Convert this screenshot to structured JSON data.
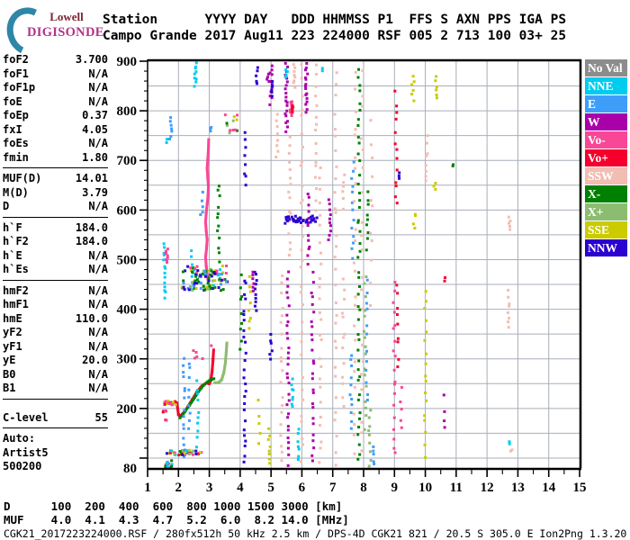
{
  "header": {
    "logo_line1": "Lowell",
    "logo_line2": "DIGISONDE",
    "title_line1": "Station      YYYY DAY   DDD HHMMSS P1  FFS S AXN PPS IGA PS",
    "title_line2": "Campo Grande 2017 Aug11 223 224000 RSF 005 2 713 100 03+ 25"
  },
  "params": {
    "groups": [
      {
        "rows": [
          {
            "label": "foF2",
            "value": "3.700"
          },
          {
            "label": "foF1",
            "value": "N/A"
          },
          {
            "label": "foF1p",
            "value": "N/A"
          },
          {
            "label": "foE",
            "value": "N/A"
          },
          {
            "label": "foEp",
            "value": "0.37"
          },
          {
            "label": "fxI",
            "value": "4.05"
          },
          {
            "label": "foEs",
            "value": "N/A"
          },
          {
            "label": "fmin",
            "value": "1.80"
          }
        ]
      },
      {
        "rows": [
          {
            "label": "MUF(D)",
            "value": "14.01"
          },
          {
            "label": "M(D)",
            "value": "3.79"
          },
          {
            "label": "D",
            "value": "N/A"
          }
        ]
      },
      {
        "rows": [
          {
            "label": "h`F",
            "value": "184.0"
          },
          {
            "label": "h`F2",
            "value": "184.0"
          },
          {
            "label": "h`E",
            "value": "N/A"
          },
          {
            "label": "h`Es",
            "value": "N/A"
          }
        ]
      },
      {
        "rows": [
          {
            "label": "hmF2",
            "value": "N/A"
          },
          {
            "label": "hmF1",
            "value": "N/A"
          },
          {
            "label": "hmE",
            "value": "110.0"
          },
          {
            "label": "yF2",
            "value": "N/A"
          },
          {
            "label": "yF1",
            "value": "N/A"
          },
          {
            "label": "yE",
            "value": "20.0"
          },
          {
            "label": "B0",
            "value": "N/A"
          },
          {
            "label": "B1",
            "value": "N/A"
          }
        ]
      },
      {
        "gap_before": 9,
        "rows": [
          {
            "label": "C-level",
            "value": "55"
          }
        ]
      },
      {
        "rows": [
          {
            "label": "Auto:",
            "value": ""
          },
          {
            "label": "Artist5",
            "value": ""
          },
          {
            "label": "500200",
            "value": ""
          }
        ]
      }
    ]
  },
  "legend": {
    "items": [
      {
        "label": "No Val",
        "color": "#8c8c8c"
      },
      {
        "label": "NNE",
        "color": "#00ccf0"
      },
      {
        "label": "E",
        "color": "#3f9dfa"
      },
      {
        "label": "W",
        "color": "#aa00aa"
      },
      {
        "label": "Vo-",
        "color": "#fa4696"
      },
      {
        "label": "Vo+",
        "color": "#f5002d"
      },
      {
        "label": "SSW",
        "color": "#f2bdb2"
      },
      {
        "label": "X-",
        "color": "#008000"
      },
      {
        "label": "X+",
        "color": "#8cbc70"
      },
      {
        "label": "SSE",
        "color": "#cbcb00"
      },
      {
        "label": "NNW",
        "color": "#2b00d0"
      }
    ]
  },
  "chart_data": {
    "type": "scatter",
    "title": "Ionogram echoes: virtual height [km] vs frequency [MHz]",
    "xlim": [
      1,
      15
    ],
    "ylim": [
      80,
      900
    ],
    "x_ticks": [
      1,
      2,
      3,
      4,
      5,
      6,
      7,
      8,
      9,
      10,
      11,
      12,
      13,
      14,
      15
    ],
    "y_tick_labels": [
      900,
      800,
      700,
      600,
      500,
      400,
      300,
      200,
      80
    ],
    "grid": {
      "x_step": 1,
      "y_step": 50,
      "color": "#a8aeb8"
    },
    "colors": {
      "gray": "#8c8c8c",
      "nne": "#00ccf0",
      "e": "#3f9dfa",
      "w": "#aa00aa",
      "vom": "#fa4696",
      "vop": "#f5002d",
      "ssw": "#f2bdb2",
      "xm": "#008000",
      "xp": "#8cbc70",
      "sse": "#cbcb00",
      "nnw": "#2b00d0",
      "blk": "#000000"
    },
    "traces": [
      {
        "name": "F-trace-O-mode",
        "color": "vop",
        "black_line": true,
        "points": [
          [
            1.62,
            212
          ],
          [
            1.8,
            212
          ],
          [
            1.95,
            211
          ],
          [
            2.0,
            188
          ],
          [
            2.05,
            184
          ],
          [
            2.15,
            190
          ],
          [
            2.3,
            203
          ],
          [
            2.45,
            218
          ],
          [
            2.6,
            233
          ],
          [
            2.75,
            245
          ],
          [
            2.9,
            251
          ],
          [
            3.0,
            250
          ],
          [
            3.05,
            257
          ],
          [
            3.09,
            275
          ],
          [
            3.12,
            298
          ],
          [
            3.14,
            318
          ]
        ]
      },
      {
        "name": "F-trace-X-dark",
        "color": "xm",
        "black_line": false,
        "points": [
          [
            2.05,
            181
          ],
          [
            2.2,
            193
          ],
          [
            2.35,
            206
          ],
          [
            2.5,
            220
          ],
          [
            2.65,
            234
          ],
          [
            2.8,
            246
          ],
          [
            2.95,
            254
          ],
          [
            3.05,
            258
          ],
          [
            3.15,
            260
          ]
        ]
      },
      {
        "name": "F-trace-X-light",
        "color": "xp",
        "black_line": false,
        "points": [
          [
            3.18,
            252
          ],
          [
            3.3,
            252
          ],
          [
            3.4,
            258
          ],
          [
            3.47,
            272
          ],
          [
            3.52,
            292
          ],
          [
            3.55,
            315
          ],
          [
            3.57,
            332
          ]
        ]
      },
      {
        "name": "second-hop-trace",
        "color": "vom",
        "black_line": false,
        "points": [
          [
            2.97,
            455
          ],
          [
            2.93,
            470
          ],
          [
            2.9,
            487
          ],
          [
            2.88,
            505
          ],
          [
            2.91,
            522
          ],
          [
            2.93,
            540
          ],
          [
            2.9,
            558
          ],
          [
            2.88,
            576
          ],
          [
            2.9,
            594
          ],
          [
            2.93,
            612
          ],
          [
            2.96,
            630
          ],
          [
            2.97,
            648
          ],
          [
            2.95,
            666
          ],
          [
            2.93,
            684
          ],
          [
            2.95,
            702
          ],
          [
            2.97,
            722
          ],
          [
            2.98,
            742
          ]
        ]
      }
    ],
    "columns": [
      [
        1.55,
        "nne",
        420,
        535,
        14
      ],
      [
        1.62,
        "vom",
        492,
        524,
        9
      ],
      [
        1.75,
        "e",
        738,
        792,
        7
      ],
      [
        1.6,
        "nne",
        735,
        745,
        2
      ],
      [
        2.18,
        "e",
        95,
        310,
        15
      ],
      [
        2.35,
        "e",
        150,
        305,
        9
      ],
      [
        2.55,
        "nne",
        848,
        898,
        9
      ],
      [
        2.42,
        "nne",
        430,
        520,
        8
      ],
      [
        2.62,
        "nne",
        120,
        262,
        10
      ],
      [
        2.75,
        "e",
        580,
        640,
        5
      ],
      [
        3.05,
        "e",
        755,
        770,
        3
      ],
      [
        3.3,
        "xm",
        495,
        660,
        12
      ],
      [
        4.02,
        "xm",
        310,
        480,
        9
      ],
      [
        4.15,
        "nnw",
        82,
        470,
        26
      ],
      [
        4.15,
        "nnw",
        640,
        760,
        8
      ],
      [
        4.3,
        "sse",
        348,
        472,
        8
      ],
      [
        4.5,
        "nnw",
        392,
        482,
        10
      ],
      [
        4.42,
        "w",
        432,
        480,
        6
      ],
      [
        4.55,
        "nnw",
        850,
        892,
        5
      ],
      [
        4.62,
        "sse",
        120,
        220,
        5
      ],
      [
        4.95,
        "sse",
        82,
        162,
        8
      ],
      [
        5.0,
        "w",
        812,
        898,
        11
      ],
      [
        5.05,
        "nnw",
        828,
        862,
        6
      ],
      [
        5.0,
        "nnw",
        298,
        352,
        6
      ],
      [
        4.9,
        "w",
        855,
        875,
        4
      ],
      [
        5.35,
        "ssw",
        82,
        478,
        20
      ],
      [
        5.2,
        "ssw",
        700,
        800,
        8
      ],
      [
        5.5,
        "w",
        756,
        898,
        20
      ],
      [
        5.55,
        "w",
        82,
        478,
        30
      ],
      [
        5.6,
        "ssw",
        500,
        755,
        16
      ],
      [
        5.65,
        "vom",
        788,
        822,
        9
      ],
      [
        5.68,
        "vop",
        797,
        813,
        5
      ],
      [
        5.7,
        "nne",
        198,
        262,
        8
      ],
      [
        5.75,
        "ssw",
        845,
        898,
        8
      ],
      [
        5.5,
        "nne",
        865,
        885,
        4
      ],
      [
        5.9,
        "nne",
        88,
        162,
        7
      ],
      [
        6.0,
        "ssw",
        82,
        898,
        32
      ],
      [
        6.15,
        "w",
        795,
        898,
        16
      ],
      [
        6.22,
        "w",
        488,
        642,
        13
      ],
      [
        6.35,
        "w",
        82,
        478,
        26
      ],
      [
        6.45,
        "ssw",
        598,
        898,
        16
      ],
      [
        6.6,
        "ssw",
        82,
        698,
        26
      ],
      [
        6.7,
        "nne",
        878,
        888,
        2
      ],
      [
        6.9,
        "w",
        538,
        622,
        10
      ],
      [
        7.1,
        "ssw",
        82,
        898,
        30
      ],
      [
        7.35,
        "ssw",
        198,
        478,
        13
      ],
      [
        7.35,
        "ssw",
        600,
        680,
        6
      ],
      [
        7.6,
        "e",
        148,
        322,
        11
      ],
      [
        7.65,
        "e",
        495,
        705,
        13
      ],
      [
        7.72,
        "ssw",
        82,
        898,
        24
      ],
      [
        7.85,
        "xm",
        82,
        898,
        46
      ],
      [
        7.95,
        "ssw",
        82,
        898,
        20
      ],
      [
        8.05,
        "xp",
        148,
        478,
        16
      ],
      [
        8.1,
        "e",
        198,
        472,
        12
      ],
      [
        8.12,
        "xm",
        518,
        642,
        9
      ],
      [
        8.2,
        "xp",
        82,
        202,
        9
      ],
      [
        8.25,
        "ssw",
        398,
        798,
        11
      ],
      [
        8.3,
        "e",
        80,
        130,
        5
      ],
      [
        9.0,
        "vom",
        98,
        462,
        19
      ],
      [
        9.05,
        "vop",
        598,
        842,
        13
      ],
      [
        9.1,
        "vop",
        278,
        462,
        9
      ],
      [
        9.2,
        "vom",
        148,
        252,
        5
      ],
      [
        9.15,
        "nnw",
        660,
        680,
        3
      ],
      [
        9.6,
        "sse",
        818,
        872,
        6
      ],
      [
        9.65,
        "sse",
        560,
        600,
        4
      ],
      [
        10.0,
        "sse",
        98,
        445,
        17
      ],
      [
        10.05,
        "ssw",
        648,
        752,
        8
      ],
      [
        10.35,
        "sse",
        818,
        872,
        6
      ],
      [
        10.3,
        "sse",
        640,
        660,
        3
      ],
      [
        10.6,
        "w",
        148,
        235,
        4
      ],
      [
        10.62,
        "vop",
        455,
        465,
        2
      ],
      [
        10.9,
        "xm",
        688,
        695,
        2
      ],
      [
        12.7,
        "ssw",
        358,
        442,
        8
      ],
      [
        12.72,
        "ssw",
        556,
        592,
        5
      ],
      [
        12.75,
        "nne",
        128,
        136,
        2
      ],
      [
        12.8,
        "ssw",
        112,
        120,
        2
      ]
    ],
    "clusters": [
      [
        1.6,
        2.75,
        106,
        116,
        46,
        [
          "xm",
          "vop",
          "sse",
          "vom",
          "nne",
          "xp",
          "nnw"
        ]
      ],
      [
        1.55,
        1.95,
        207,
        215,
        16,
        [
          "vom",
          "vop",
          "sse"
        ]
      ],
      [
        1.5,
        1.62,
        168,
        200,
        6,
        [
          "vop",
          "vom"
        ]
      ],
      [
        1.55,
        1.8,
        80,
        95,
        16,
        [
          "vom",
          "vop",
          "nne",
          "xm",
          "e"
        ]
      ],
      [
        2.1,
        3.6,
        435,
        488,
        80,
        [
          "vom",
          "xm",
          "nnw",
          "e",
          "nne",
          "xp",
          "sse"
        ]
      ],
      [
        2.4,
        3.2,
        438,
        478,
        30,
        [
          "nnw",
          "e",
          "xm"
        ]
      ],
      [
        5.45,
        6.5,
        573,
        588,
        40,
        [
          "nnw"
        ]
      ],
      [
        3.5,
        3.95,
        752,
        792,
        12,
        [
          "vom",
          "xm",
          "sse",
          "xp"
        ]
      ],
      [
        2.3,
        3.3,
        300,
        330,
        6,
        [
          "vom",
          "w"
        ]
      ]
    ]
  },
  "dmuf": {
    "d_label": "D",
    "muf_label": "MUF",
    "d": [
      "100",
      "200",
      "400",
      "600",
      "800",
      "1000",
      "1500",
      "3000"
    ],
    "muf": [
      "4.0",
      "4.1",
      "4.3",
      "4.7",
      "5.2",
      "6.0",
      "8.2",
      "14.0"
    ],
    "d_unit": "[km]",
    "muf_unit": "[MHz]"
  },
  "footer": {
    "status_line": "CGK21_2017223224000.RSF / 280fx512h 50 kHz 2.5 km / DPS-4D CGK21 821 / 20.5 S 305.0 E Ion2Png 1.3.20"
  }
}
